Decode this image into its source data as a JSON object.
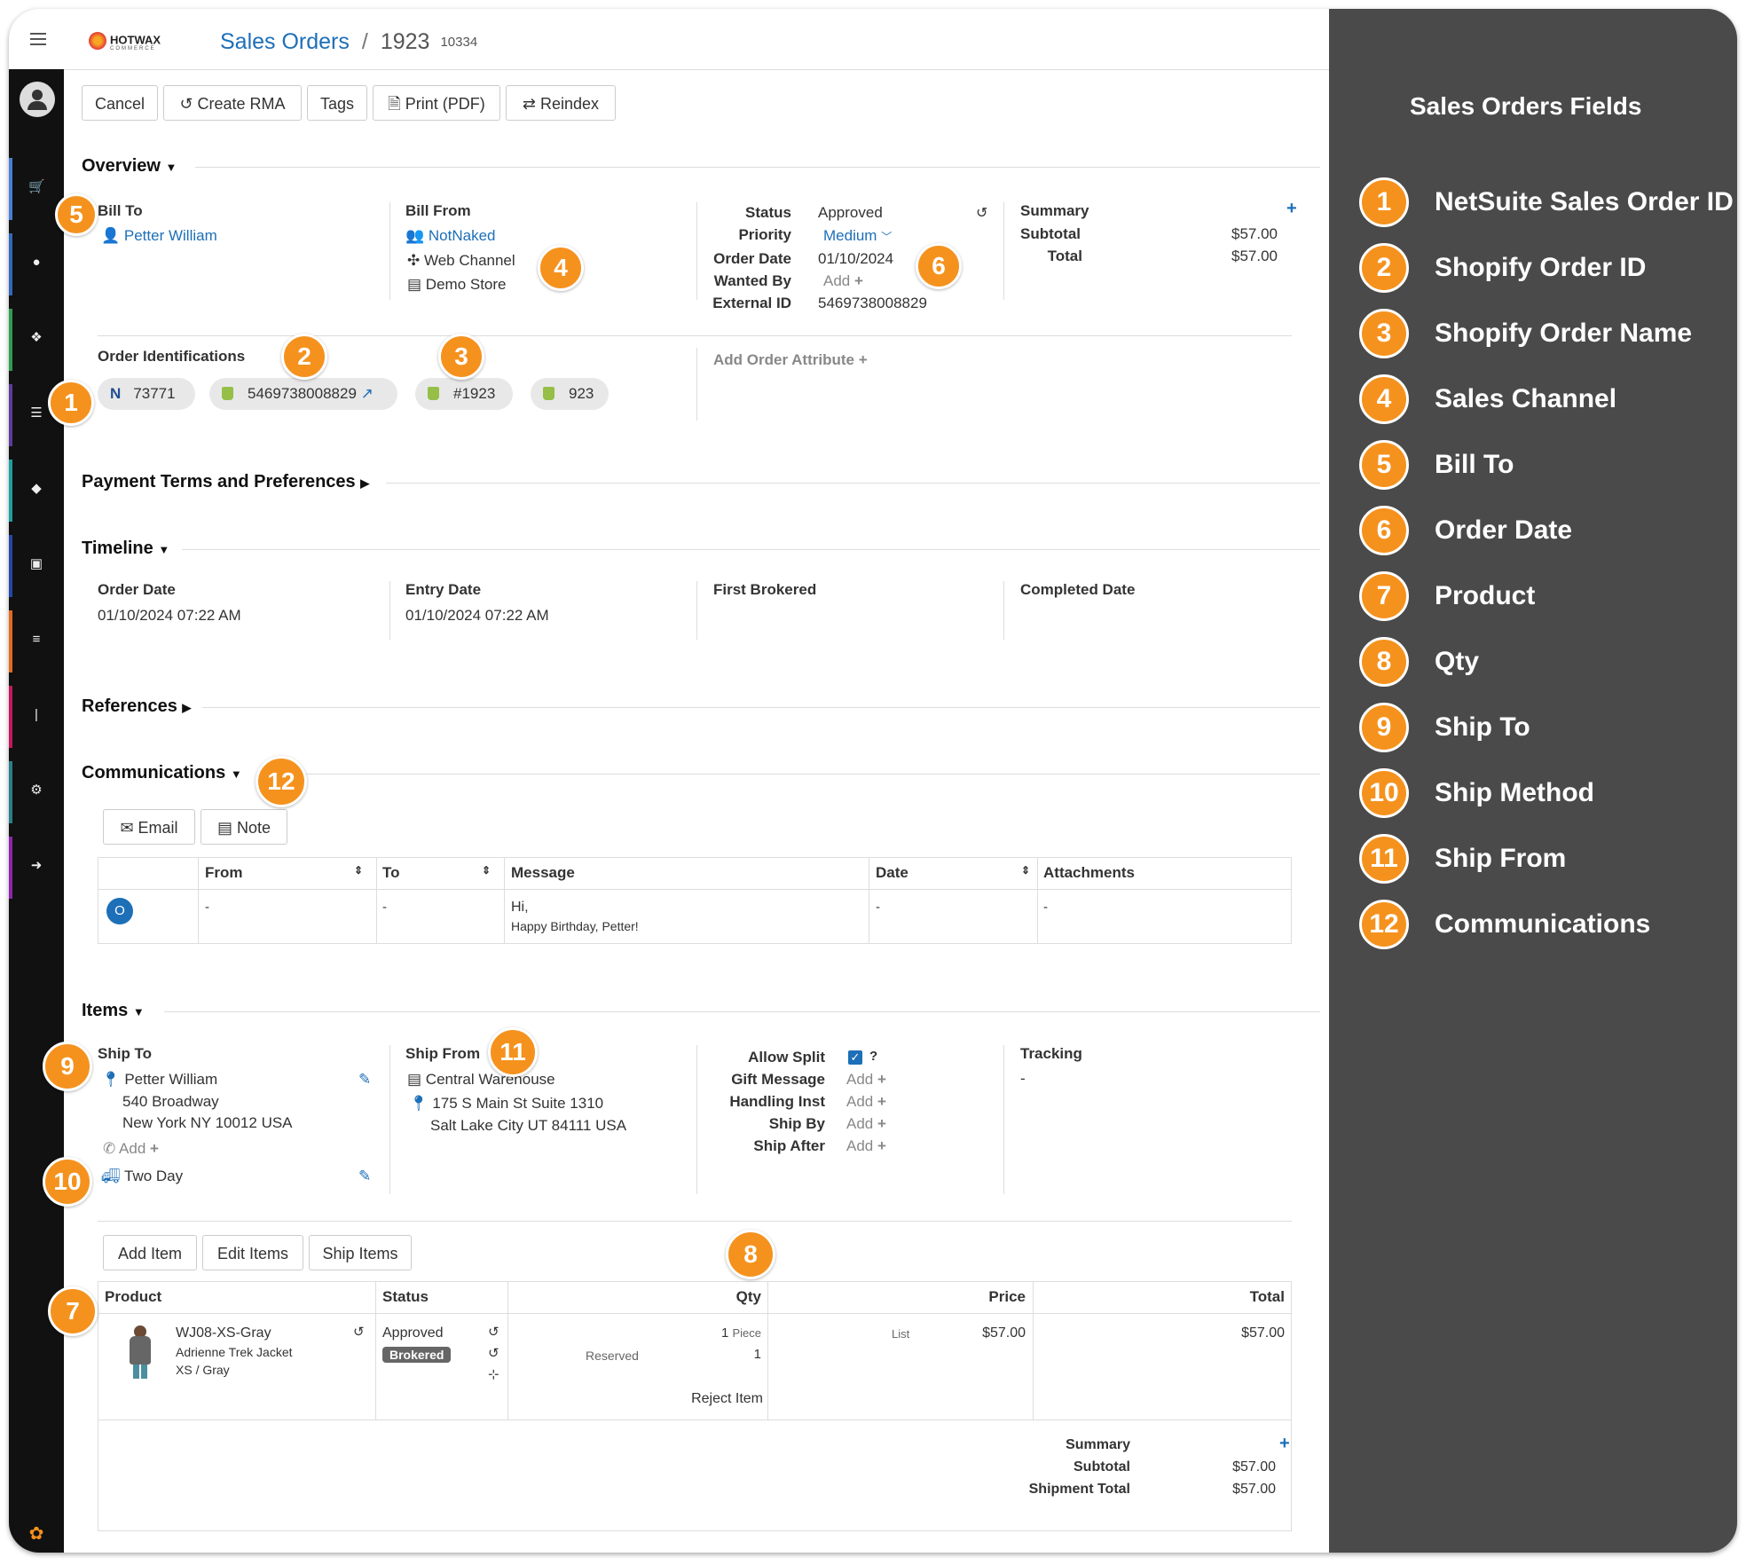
{
  "header": {
    "breadcrumb_root": "Sales Orders",
    "breadcrumb_current": "1923",
    "breadcrumb_sub": "10334",
    "logo_text": "HOTWAX",
    "logo_sub": "COMMERCE"
  },
  "toolbar": {
    "cancel": "Cancel",
    "create_rma": "Create RMA",
    "tags": "Tags",
    "print": "Print (PDF)",
    "reindex": "Reindex"
  },
  "overview": {
    "title": "Overview",
    "bill_to_label": "Bill To",
    "bill_to_name": "Petter William",
    "bill_from_label": "Bill From",
    "bill_from_company": "NotNaked",
    "bill_from_channel": "Web Channel",
    "bill_from_store": "Demo Store",
    "status_label": "Status",
    "status_value": "Approved",
    "priority_label": "Priority",
    "priority_value": "Medium",
    "order_date_label": "Order Date",
    "order_date_value": "01/10/2024",
    "wanted_by_label": "Wanted By",
    "wanted_by_value": "Add",
    "external_id_label": "External ID",
    "external_id_value": "5469738008829",
    "summary_label": "Summary",
    "subtotal_label": "Subtotal",
    "subtotal_value": "$57.00",
    "total_label": "Total",
    "total_value": "$57.00",
    "order_ident_label": "Order Identifications",
    "ids": [
      "73771",
      "5469738008829",
      "#1923",
      "923"
    ],
    "add_attr": "Add Order Attribute"
  },
  "payment": {
    "title": "Payment Terms and Preferences"
  },
  "timeline": {
    "title": "Timeline",
    "cols": [
      {
        "label": "Order Date",
        "value": "01/10/2024 07:22 AM"
      },
      {
        "label": "Entry Date",
        "value": "01/10/2024 07:22 AM"
      },
      {
        "label": "First Brokered",
        "value": ""
      },
      {
        "label": "Completed Date",
        "value": ""
      }
    ]
  },
  "references": {
    "title": "References"
  },
  "communications": {
    "title": "Communications",
    "email_btn": "Email",
    "note_btn": "Note",
    "headers": [
      "From",
      "To",
      "Message",
      "Date",
      "Attachments"
    ],
    "row": {
      "avatar": "O",
      "from": "-",
      "to": "-",
      "message_line1": "Hi,",
      "message_line2": "Happy Birthday, Petter!",
      "date": "-",
      "attachments": "-"
    }
  },
  "items": {
    "title": "Items",
    "ship_to_label": "Ship To",
    "ship_to_name": "Petter William",
    "ship_to_addr1": "540 Broadway",
    "ship_to_addr2": "New York NY 10012 USA",
    "ship_to_phone": "Add",
    "ship_method": "Two Day",
    "ship_from_label": "Ship From",
    "ship_from_name": "Central Warehouse",
    "ship_from_addr1": "175 S Main St Suite 1310",
    "ship_from_addr2": "Salt Lake City UT 84111 USA",
    "allow_split_label": "Allow Split",
    "gift_message_label": "Gift Message",
    "handling_label": "Handling Inst",
    "ship_by_label": "Ship By",
    "ship_after_label": "Ship After",
    "add": "Add",
    "tracking_label": "Tracking",
    "tracking_value": "-",
    "add_item": "Add Item",
    "edit_items": "Edit Items",
    "ship_items": "Ship Items",
    "headers": [
      "Product",
      "Status",
      "Qty",
      "Price",
      "Total"
    ],
    "row": {
      "sku": "WJ08-XS-Gray",
      "name": "Adrienne Trek Jacket",
      "variant": "XS / Gray",
      "status": "Approved",
      "status_tag": "Brokered",
      "qty": "1",
      "qty_unit": "Piece",
      "reserved_label": "Reserved",
      "reserved_qty": "1",
      "reject": "Reject Item",
      "price_type": "List",
      "price": "$57.00",
      "total": "$57.00"
    },
    "summary_label": "Summary",
    "subtotal_label": "Subtotal",
    "subtotal_value": "$57.00",
    "shipment_total_label": "Shipment Total",
    "shipment_total_value": "$57.00"
  },
  "panel": {
    "title": "Sales Orders Fields",
    "items": [
      {
        "n": "1",
        "name": "NetSuite Sales Order ID"
      },
      {
        "n": "2",
        "name": "Shopify Order ID"
      },
      {
        "n": "3",
        "name": "Shopify Order Name"
      },
      {
        "n": "4",
        "name": "Sales Channel"
      },
      {
        "n": "5",
        "name": "Bill To"
      },
      {
        "n": "6",
        "name": "Order Date"
      },
      {
        "n": "7",
        "name": "Product"
      },
      {
        "n": "8",
        "name": "Qty"
      },
      {
        "n": "9",
        "name": "Ship To"
      },
      {
        "n": "10",
        "name": "Ship Method"
      },
      {
        "n": "11",
        "name": "Ship From"
      },
      {
        "n": "12",
        "name": "Communications"
      }
    ]
  },
  "colors": {
    "accent": "#f5921e",
    "link": "#1d6fb8",
    "panel_bg": "#4a4a4a",
    "sidebar_bg": "#111111"
  }
}
